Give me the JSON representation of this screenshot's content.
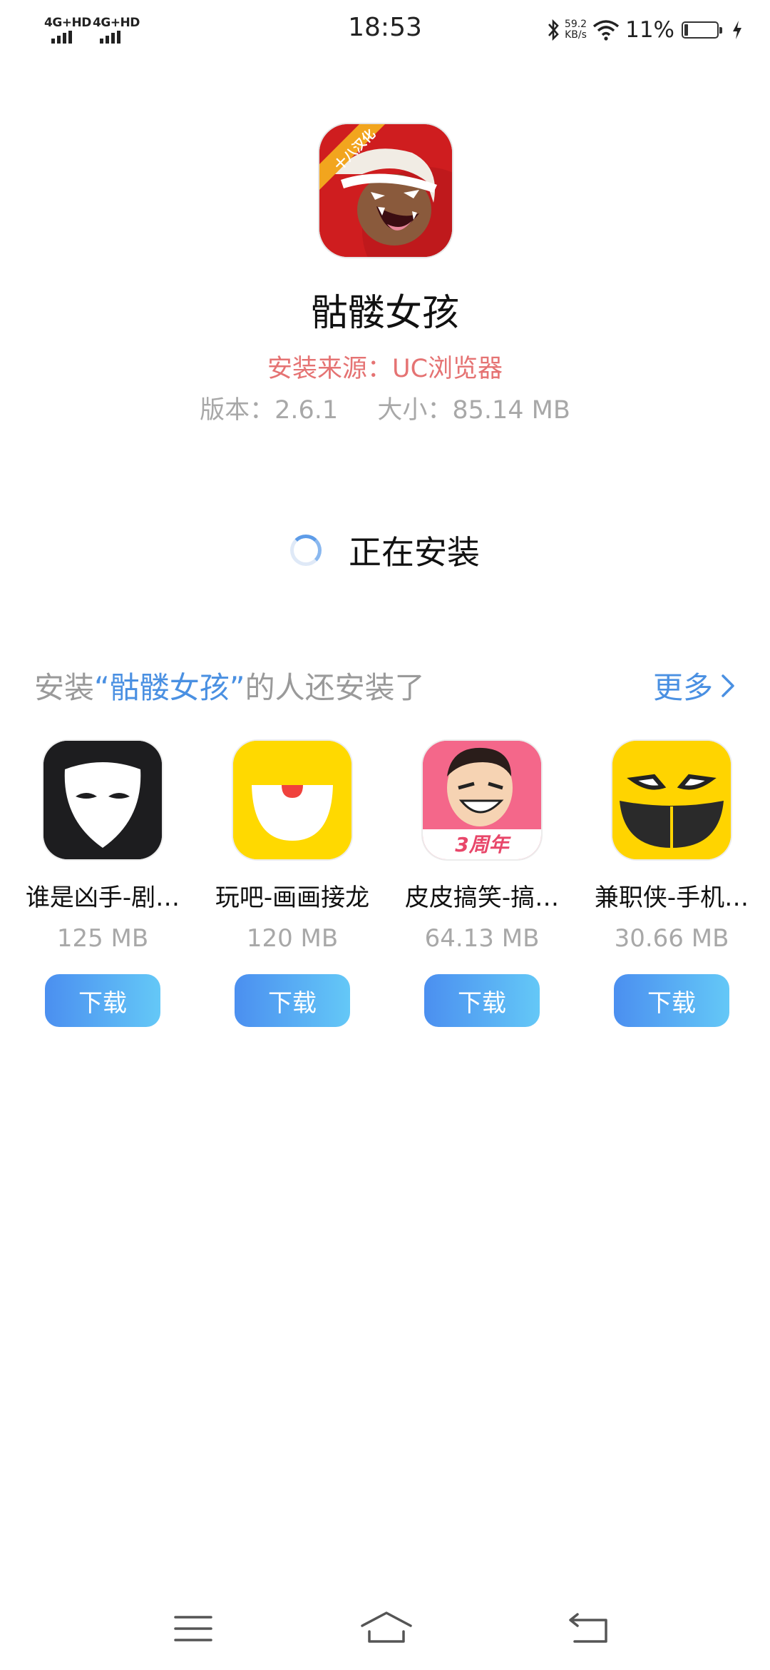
{
  "status_bar": {
    "sim1": "4G+HD",
    "sim2": "4G+HD",
    "time": "18:53",
    "net_speed": "59.2",
    "net_unit": "KB/s",
    "battery": "11%",
    "battery_level": 0.11,
    "icons": [
      "bluetooth-icon",
      "wifi-icon",
      "battery-icon",
      "charging-icon"
    ]
  },
  "app": {
    "icon_badge": "十八汉化",
    "name": "骷髅女孩",
    "source": "安装来源：UC浏览器",
    "version": "版本：2.6.1",
    "size": "大小：85.14 MB"
  },
  "install": {
    "status": "正在安装"
  },
  "recommend": {
    "prefix": "安装",
    "open_quote": "“",
    "app_name": "骷髅女孩",
    "close_quote": "”",
    "suffix": "的人还安装了",
    "more": "更多",
    "items": [
      {
        "name": "谁是凶手-剧…",
        "size": "125 MB",
        "button": "下载",
        "icon": "mask-icon"
      },
      {
        "name": "玩吧-画画接龙",
        "size": "120 MB",
        "button": "下载",
        "icon": "wanba-icon"
      },
      {
        "name": "皮皮搞笑-搞…",
        "size": "64.13 MB",
        "button": "下载",
        "icon": "pipi-icon",
        "badge": "3周年"
      },
      {
        "name": "兼职侠-手机…",
        "size": "30.66 MB",
        "button": "下载",
        "icon": "jianzhixia-icon"
      }
    ]
  },
  "colors": {
    "accent": "#4a90e2",
    "source_text": "#e57373",
    "muted": "#a8a8a8",
    "button_start": "#4b8ff0",
    "button_end": "#64c8f7"
  },
  "nav": {
    "icons": [
      "menu-icon",
      "home-icon",
      "back-icon"
    ]
  }
}
